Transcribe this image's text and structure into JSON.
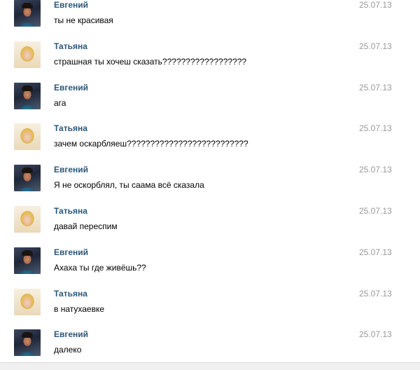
{
  "messages": [
    {
      "author": "Евгений",
      "avatar": "yevgeny",
      "text": "ты не красивая",
      "date": "25.07.13"
    },
    {
      "author": "Татьяна",
      "avatar": "tatyana",
      "text": "страшная ты хочеш сказать??????????????????",
      "date": "25.07.13"
    },
    {
      "author": "Евгений",
      "avatar": "yevgeny",
      "text": "ага",
      "date": "25.07.13"
    },
    {
      "author": "Татьяна",
      "avatar": "tatyana",
      "text": "зачем оскарбляеш??????????????????????????",
      "date": "25.07.13"
    },
    {
      "author": "Евгений",
      "avatar": "yevgeny",
      "text": "Я не оскорблял, ты саама всё сказала",
      "date": "25.07.13"
    },
    {
      "author": "Татьяна",
      "avatar": "tatyana",
      "text": "давай переспим",
      "date": "25.07.13"
    },
    {
      "author": "Евгений",
      "avatar": "yevgeny",
      "text": "Ахаха ты где живёшь??",
      "date": "25.07.13"
    },
    {
      "author": "Татьяна",
      "avatar": "tatyana",
      "text": "в натухаевке",
      "date": "25.07.13"
    },
    {
      "author": "Евгений",
      "avatar": "yevgeny",
      "text": "далеко",
      "date": "25.07.13"
    }
  ],
  "colors": {
    "author_name": "#2b587a",
    "message_text": "#000000",
    "date": "#999999",
    "background": "#ffffff"
  }
}
